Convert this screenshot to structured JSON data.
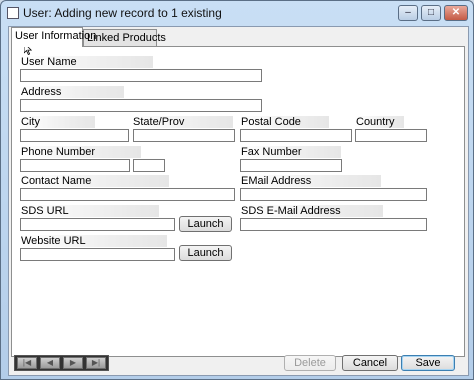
{
  "window": {
    "title": "User: Adding new record to 1 existing",
    "minimize_glyph": "–",
    "restore_glyph": "□",
    "close_glyph": "✕"
  },
  "tabs": [
    {
      "label": "User Information",
      "active": true
    },
    {
      "label": "Linked Products",
      "active": false
    }
  ],
  "form": {
    "user_name": {
      "label": "User Name",
      "value": ""
    },
    "address": {
      "label": "Address",
      "value": ""
    },
    "city": {
      "label": "City",
      "value": ""
    },
    "state": {
      "label": "State/Prov",
      "value": ""
    },
    "postal": {
      "label": "Postal Code",
      "value": ""
    },
    "country": {
      "label": "Country",
      "value": ""
    },
    "phone": {
      "label": "Phone Number",
      "value": "",
      "ext_value": ""
    },
    "fax": {
      "label": "Fax Number",
      "value": ""
    },
    "contact": {
      "label": "Contact Name",
      "value": ""
    },
    "email": {
      "label": "EMail Address",
      "value": ""
    },
    "sds_url": {
      "label": "SDS URL",
      "value": "",
      "button": "Launch"
    },
    "sds_email": {
      "label": "SDS E-Mail Address",
      "value": ""
    },
    "website": {
      "label": "Website URL",
      "value": "",
      "button": "Launch"
    }
  },
  "footer": {
    "nav_buttons": [
      "first-record-icon",
      "previous-record-icon",
      "next-record-icon",
      "last-record-icon"
    ],
    "delete_label": "Delete",
    "cancel_label": "Cancel",
    "save_label": "Save"
  }
}
